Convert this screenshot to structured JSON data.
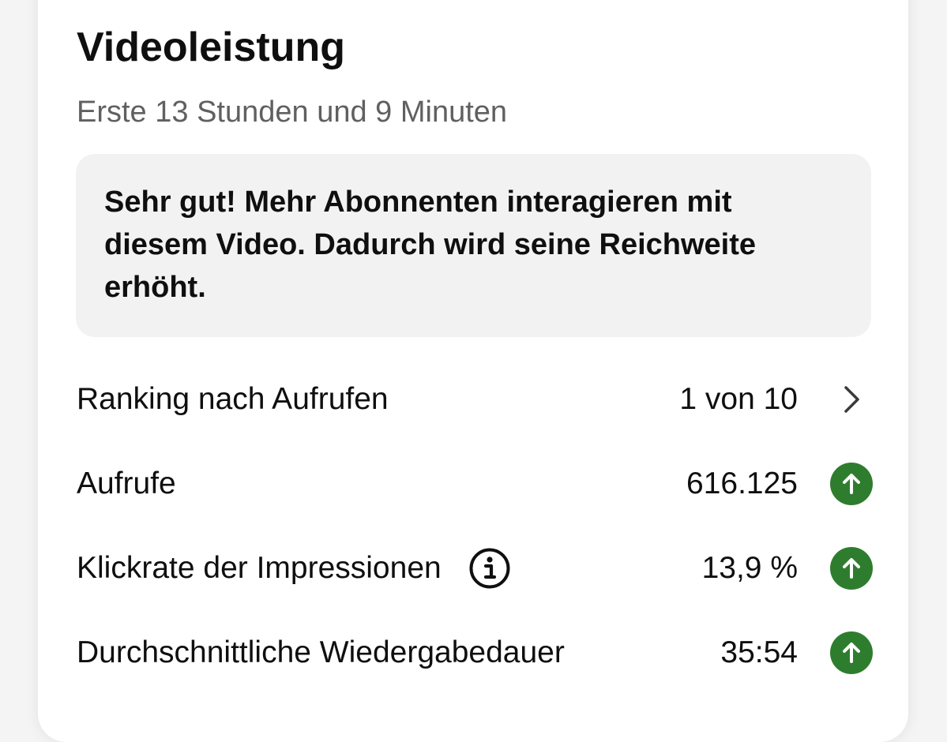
{
  "card": {
    "title": "Videoleistung",
    "subtitle": "Erste 13 Stunden und 9 Minuten",
    "notice": "Sehr gut! Mehr Abonnenten interagieren mit diesem Video. Dadurch wird seine Reichweite erhöht."
  },
  "metrics": {
    "ranking": {
      "label": "Ranking nach Aufrufen",
      "value": "1 von 10",
      "icon": "chevron-right-icon"
    },
    "views": {
      "label": "Aufrufe",
      "value": "616.125",
      "trend": "up",
      "icon": "arrow-up-circle-icon"
    },
    "ctr": {
      "label": "Klickrate der Impressionen",
      "value": "13,9 %",
      "trend": "up",
      "icon": "arrow-up-circle-icon",
      "info_icon": "info-icon"
    },
    "avg_duration": {
      "label": "Durchschnittliche Wiedergabedauer",
      "value": "35:54",
      "trend": "up",
      "icon": "arrow-up-circle-icon"
    }
  },
  "colors": {
    "trend_up": "#2e7d2e",
    "notice_bg": "#f2f2f2",
    "subtitle": "#606060"
  }
}
